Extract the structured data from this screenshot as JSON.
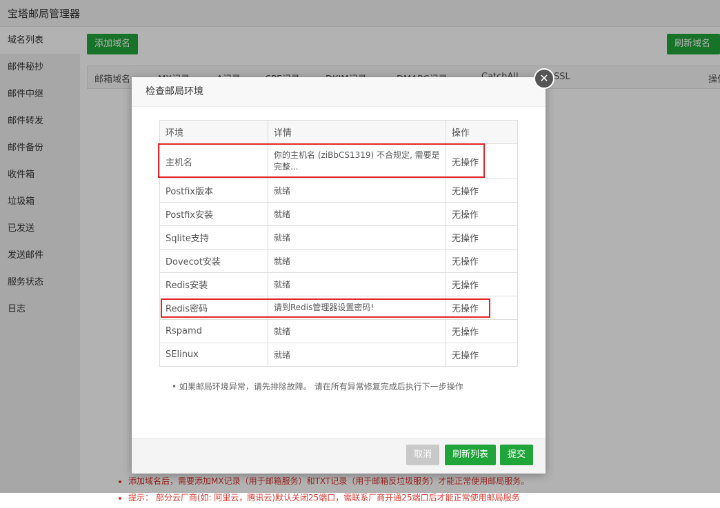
{
  "app": {
    "title": "宝塔邮局管理器"
  },
  "sidebar": {
    "items": [
      {
        "label": "域名列表"
      },
      {
        "label": "邮件秘抄"
      },
      {
        "label": "邮件中继"
      },
      {
        "label": "邮件转发"
      },
      {
        "label": "邮件备份"
      },
      {
        "label": "收件箱"
      },
      {
        "label": "垃圾箱"
      },
      {
        "label": "已发送"
      },
      {
        "label": "发送邮件"
      },
      {
        "label": "服务状态"
      },
      {
        "label": "日志"
      }
    ]
  },
  "main": {
    "add_domain_label": "添加域名",
    "refresh_domain_label": "刷新域名记录",
    "columns": [
      "邮箱域名",
      "MX记录",
      "A记录",
      "SPF记录",
      "DKIM记录",
      "DMARC记录",
      "CatchAll",
      "SSL",
      "操作"
    ],
    "tips": [
      "添加域名后，需要添加MX记录（用于邮箱服务）和TXT记录（用于邮箱反垃圾服务）才能正常使用邮局服务。",
      "提示： 部分云厂商(如: 阿里云，腾讯云)默认关闭25端口，需联系厂商开通25端口后才能正常使用邮局服务"
    ]
  },
  "dialog": {
    "title": "检查邮局环境",
    "close_symbol": "✕",
    "headers": [
      "环境",
      "详情",
      "操作"
    ],
    "rows": [
      {
        "env": "主机名",
        "detail": "你的主机名 (ziBbCS1319) 不合规定, 需要是完整...",
        "action": "无操作",
        "status": "error"
      },
      {
        "env": "Postfix版本",
        "detail": "就绪",
        "action": "无操作",
        "status": "ok"
      },
      {
        "env": "Postfix安装",
        "detail": "就绪",
        "action": "无操作",
        "status": "ok"
      },
      {
        "env": "Sqlite支持",
        "detail": "就绪",
        "action": "无操作",
        "status": "ok"
      },
      {
        "env": "Dovecot安装",
        "detail": "就绪",
        "action": "无操作",
        "status": "ok"
      },
      {
        "env": "Redis安装",
        "detail": "就绪",
        "action": "无操作",
        "status": "ok"
      },
      {
        "env": "Redis密码",
        "detail": "请到Redis管理器设置密码!",
        "action": "无操作",
        "status": "error"
      },
      {
        "env": "Rspamd",
        "detail": "就绪",
        "action": "无操作",
        "status": "ok"
      },
      {
        "env": "SElinux",
        "detail": "就绪",
        "action": "无操作",
        "status": "ok"
      }
    ],
    "note": "如果邮局环境异常，请先排除故障。 请在所有异常修复完成后执行下一步操作",
    "buttons": {
      "cancel": "取消",
      "refresh": "刷新列表",
      "submit": "提交"
    }
  },
  "colors": {
    "accent": "#20a53a",
    "error": "#e3252a",
    "disabled": "#c9c9c9"
  }
}
